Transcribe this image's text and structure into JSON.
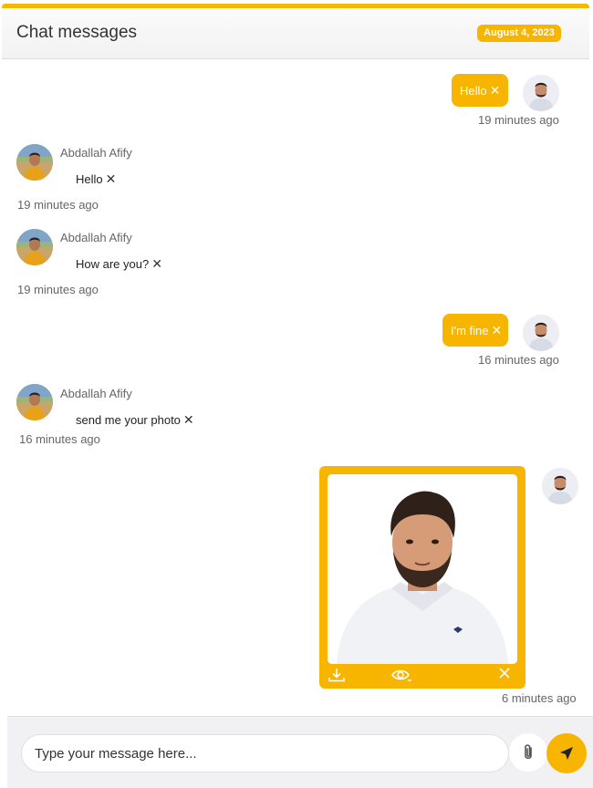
{
  "header": {
    "title": "Chat messages",
    "date": "August 4, 2023"
  },
  "contact": {
    "name": "Abdallah Afify"
  },
  "messages": [
    {
      "direction": "out",
      "text": "Hello",
      "time": "19 minutes ago"
    },
    {
      "direction": "in",
      "text": "Hello",
      "time": "19 minutes ago"
    },
    {
      "direction": "in",
      "text": "How are you?",
      "time": "19 minutes ago"
    },
    {
      "direction": "out",
      "text": "I'm fine",
      "time": "16 minutes ago"
    },
    {
      "direction": "in",
      "text": "send me your photo",
      "time": "16 minutes ago"
    },
    {
      "direction": "out",
      "type": "image",
      "time": "6 minutes ago"
    }
  ],
  "delete_glyph": "✕",
  "composer": {
    "placeholder": "Type your message here..."
  },
  "icons": {
    "download": "download-icon",
    "view": "eye-icon",
    "delete": "close-icon",
    "attach": "paperclip-icon",
    "send": "send-icon"
  },
  "colors": {
    "accent": "#f7b500",
    "text": "#333333",
    "muted": "#666666"
  }
}
